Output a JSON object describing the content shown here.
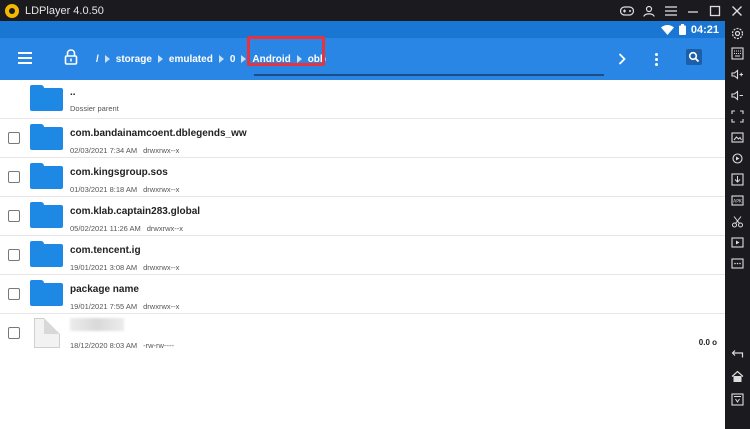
{
  "window": {
    "title": "LDPlayer 4.0.50"
  },
  "status_bar": {
    "time": "04:21"
  },
  "breadcrumb": {
    "items": [
      "/",
      "storage",
      "emulated",
      "0",
      "Android",
      "obb"
    ]
  },
  "files": [
    {
      "name": "..",
      "subtitle": "Dossier parent",
      "type": "parent"
    },
    {
      "name": "com.bandainamcoent.dblegends_ww",
      "date": "02/03/2021 7:34 AM",
      "perms": "drwxrwx--x",
      "type": "folder"
    },
    {
      "name": "com.kingsgroup.sos",
      "date": "01/03/2021 8:18 AM",
      "perms": "drwxrwx--x",
      "type": "folder"
    },
    {
      "name": "com.klab.captain283.global",
      "date": "05/02/2021 11:26 AM",
      "perms": "drwxrwx--x",
      "type": "folder"
    },
    {
      "name": "com.tencent.ig",
      "date": "19/01/2021 3:08 AM",
      "perms": "drwxrwx--x",
      "type": "folder"
    },
    {
      "name": "package name",
      "date": "19/01/2021 7:55 AM",
      "perms": "drwxrwx--x",
      "type": "folder"
    },
    {
      "name": "",
      "date": "18/12/2020 8:03 AM",
      "perms": "-rw-rw----",
      "size": "0.0 o",
      "type": "file"
    }
  ],
  "colors": {
    "app_bar": "#2a86e4",
    "status_bar": "#1976d2",
    "folder": "#1e88e5",
    "highlight": "#e8323c"
  }
}
